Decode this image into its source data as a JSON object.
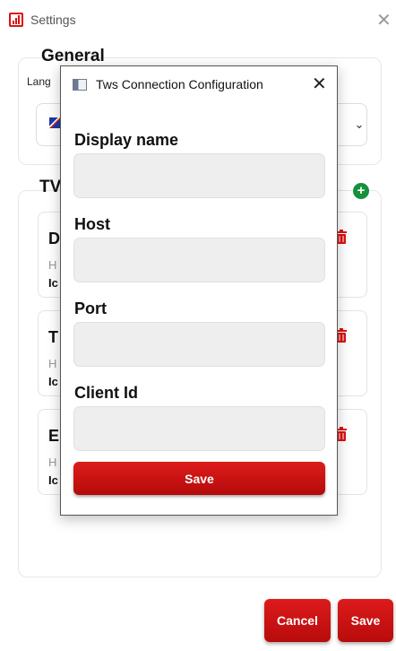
{
  "window": {
    "title": "Settings",
    "app_icon": "bar-chart-icon",
    "close_icon": "close-icon"
  },
  "general": {
    "title": "General",
    "language_label": "Lang",
    "language_flag": "uk-flag-icon",
    "dropdown_icon": "chevron-down-icon"
  },
  "tws": {
    "title": "TV",
    "add_icon": "plus-circle-icon",
    "connections": [
      {
        "name": "D",
        "host_label": "H",
        "id_label": "Ic"
      },
      {
        "name": "T",
        "host_label": "H",
        "id_label": "Ic"
      },
      {
        "name": "E",
        "host_label": "H",
        "id_label": "Ic"
      }
    ],
    "delete_icon": "trash-icon"
  },
  "footer": {
    "cancel_label": "Cancel",
    "save_label": "Save"
  },
  "dialog": {
    "title": "Tws Connection Configuration",
    "close_icon": "close-icon",
    "fields": [
      {
        "label": "Display name",
        "value": ""
      },
      {
        "label": "Host",
        "value": ""
      },
      {
        "label": "Port",
        "value": ""
      },
      {
        "label": "Client Id",
        "value": ""
      }
    ],
    "save_label": "Save"
  },
  "colors": {
    "accent_red": "#c81212",
    "add_green": "#15913b",
    "input_bg": "#eeeeee"
  }
}
